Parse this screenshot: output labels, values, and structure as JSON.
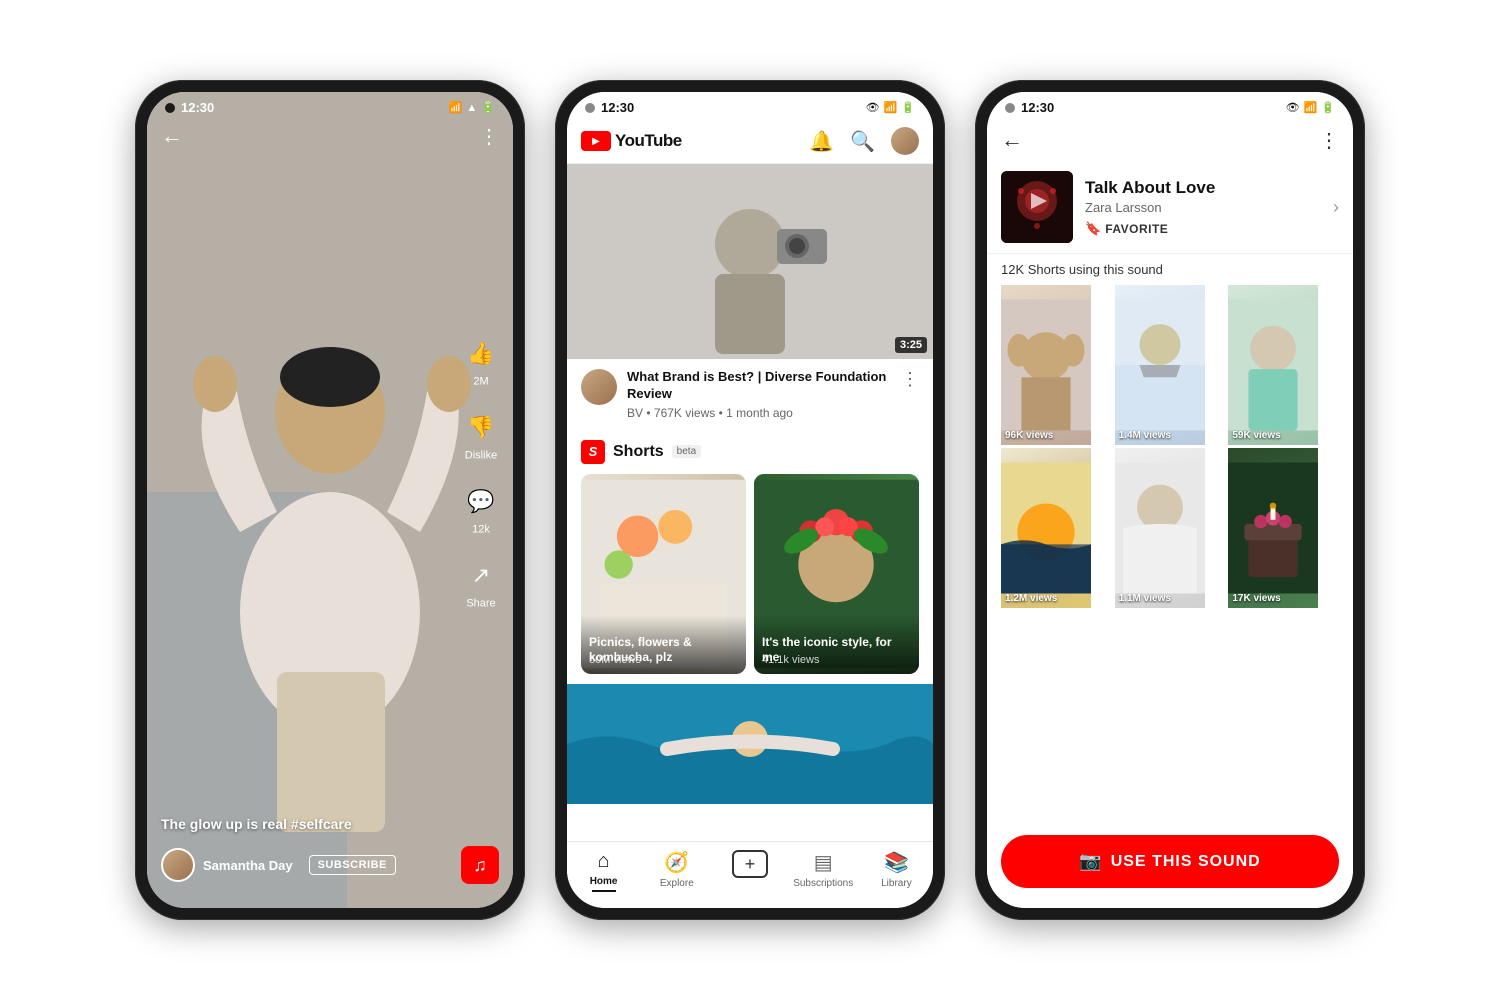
{
  "phone1": {
    "status_time": "12:30",
    "status_icons": "🔊📶📶🔋",
    "caption": "The glow up is real #selfcare",
    "hashtag": "#selfcare",
    "username": "Samantha Day",
    "subscribe_label": "SUBSCRIBE",
    "like_count": "2M",
    "dislike_label": "Dislike",
    "comment_count": "12k",
    "share_label": "Share"
  },
  "phone2": {
    "status_time": "12:30",
    "logo_text": "YouTube",
    "video_title": "What Brand is Best? | Diverse Foundation Review",
    "video_channel": "BV",
    "video_meta": "767K views • 1 month ago",
    "duration": "3:25",
    "shorts_label": "Shorts",
    "shorts_beta": "beta",
    "short1_caption": "Picnics, flowers & kombucha, plz",
    "short1_views": "50M views",
    "short2_caption": "It's the iconic style, for me",
    "short2_views": "41.1k views",
    "nav_home": "Home",
    "nav_explore": "Explore",
    "nav_subscriptions": "Subscriptions",
    "nav_library": "Library"
  },
  "phone3": {
    "status_time": "12:30",
    "song_title": "Talk About Love",
    "artist_name": "Zara Larsson",
    "favorite_label": "FAVORITE",
    "shorts_count": "12K Shorts using this sound",
    "chevron": "›",
    "use_sound_label": "USE THIS SOUND",
    "grid_views": [
      "96K views",
      "1.4M views",
      "59K views",
      "1.2M views",
      "1.1M views",
      "17K views"
    ]
  }
}
